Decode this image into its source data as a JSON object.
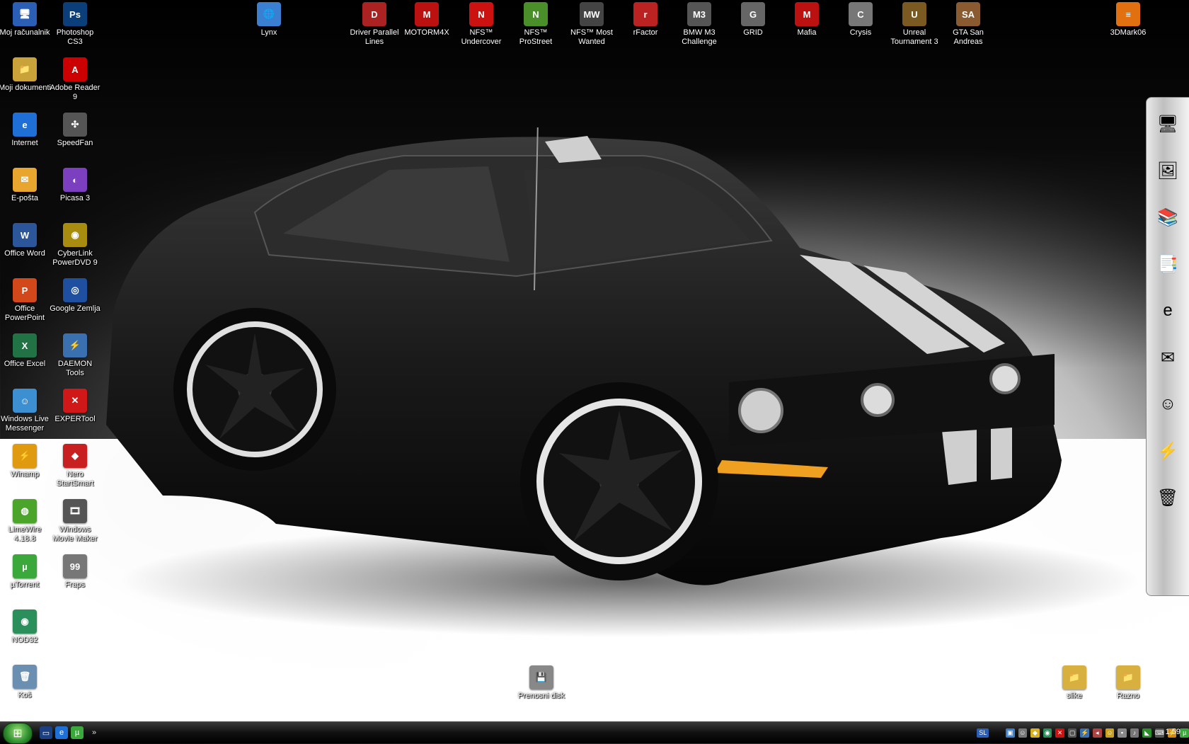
{
  "icons_left": [
    {
      "id": "computer",
      "label": "Moj računalnik",
      "glyph": "🖥",
      "color": "#2a5fb5"
    },
    {
      "id": "photoshop",
      "label": "Photoshop CS3",
      "glyph": "Ps",
      "color": "#0b3f7a"
    },
    {
      "id": "documents",
      "label": "Moji dokumenti",
      "glyph": "📁",
      "color": "#c9a23a"
    },
    {
      "id": "adobe-reader",
      "label": "Adobe Reader 9",
      "glyph": "A",
      "color": "#c00"
    },
    {
      "id": "internet",
      "label": "Internet",
      "glyph": "e",
      "color": "#1e6fd6"
    },
    {
      "id": "speedfan",
      "label": "SpeedFan",
      "glyph": "✣",
      "color": "#555"
    },
    {
      "id": "eposta",
      "label": "E-pošta",
      "glyph": "✉",
      "color": "#e8a62e"
    },
    {
      "id": "picasa",
      "label": "Picasa 3",
      "glyph": "◐",
      "color": "#7b3fbf"
    },
    {
      "id": "word",
      "label": "Office Word",
      "glyph": "W",
      "color": "#2b579a"
    },
    {
      "id": "powerdvd",
      "label": "CyberLink PowerDVD 9",
      "glyph": "◉",
      "color": "#a88c10"
    },
    {
      "id": "powerpoint",
      "label": "Office PowerPoint",
      "glyph": "P",
      "color": "#d2481b"
    },
    {
      "id": "google-earth",
      "label": "Google Zemlja",
      "glyph": "◎",
      "color": "#1f4f9f"
    },
    {
      "id": "excel",
      "label": "Office Excel",
      "glyph": "X",
      "color": "#217346"
    },
    {
      "id": "daemon",
      "label": "DAEMON Tools",
      "glyph": "⚡",
      "color": "#3a6fb0"
    },
    {
      "id": "messenger",
      "label": "Windows Live Messenger",
      "glyph": "☺",
      "color": "#3c8fd0"
    },
    {
      "id": "expertool",
      "label": "EXPERTool",
      "glyph": "✕",
      "color": "#d01818"
    },
    {
      "id": "winamp",
      "label": "Winamp",
      "glyph": "⚡",
      "color": "#e09a10"
    },
    {
      "id": "nero",
      "label": "Nero StartSmart",
      "glyph": "◆",
      "color": "#c82020"
    },
    {
      "id": "limewire",
      "label": "LimeWire 4.18.8",
      "glyph": "◍",
      "color": "#4aa52a"
    },
    {
      "id": "moviemaker",
      "label": "Windows Movie Maker",
      "glyph": "🎞",
      "color": "#555"
    },
    {
      "id": "utorrent",
      "label": "µTorrent",
      "glyph": "µ",
      "color": "#3aa83a"
    },
    {
      "id": "fraps",
      "label": "Fraps",
      "glyph": "99",
      "color": "#777"
    },
    {
      "id": "nod32",
      "label": "NOD32",
      "glyph": "◉",
      "color": "#2a8f5a"
    },
    {
      "id": "recycle",
      "label": "Koš",
      "glyph": "🗑",
      "color": "#6a8fb0"
    }
  ],
  "icons_top": [
    {
      "id": "lynx",
      "label": "Lynx",
      "glyph": "🌐",
      "color": "#3a7fd0"
    },
    {
      "id": "driver",
      "label": "Driver Parallel Lines",
      "glyph": "D",
      "color": "#a22"
    },
    {
      "id": "motorm4x",
      "label": "MOTORM4X",
      "glyph": "M",
      "color": "#b11"
    },
    {
      "id": "nfs-undercover",
      "label": "NFS™ Undercover",
      "glyph": "N",
      "color": "#c11"
    },
    {
      "id": "nfs-prostreet",
      "label": "NFS™ ProStreet",
      "glyph": "N",
      "color": "#4a8f2a"
    },
    {
      "id": "nfs-mostwanted",
      "label": "NFS™ Most Wanted",
      "glyph": "MW",
      "color": "#444"
    },
    {
      "id": "rfactor",
      "label": "rFactor",
      "glyph": "r",
      "color": "#b22"
    },
    {
      "id": "bmw",
      "label": "BMW M3 Challenge",
      "glyph": "M3",
      "color": "#555"
    },
    {
      "id": "grid",
      "label": "GRID",
      "glyph": "G",
      "color": "#666"
    },
    {
      "id": "mafia",
      "label": "Mafia",
      "glyph": "M",
      "color": "#b11"
    },
    {
      "id": "crysis",
      "label": "Crysis",
      "glyph": "C",
      "color": "#777"
    },
    {
      "id": "ut3",
      "label": "Unreal Tournament 3",
      "glyph": "U",
      "color": "#7a5a20"
    },
    {
      "id": "gtasa",
      "label": "GTA San Andreas",
      "glyph": "SA",
      "color": "#8a5a30"
    },
    {
      "id": "3dmark",
      "label": "3DMark06",
      "glyph": "≡",
      "color": "#e07010"
    }
  ],
  "icons_bottom": [
    {
      "id": "removable",
      "label": "Prenosni disk",
      "glyph": "💾",
      "color": "#888"
    },
    {
      "id": "slike",
      "label": "slike",
      "glyph": "📁",
      "color": "#d8b040"
    },
    {
      "id": "razno",
      "label": "Razno",
      "glyph": "📁",
      "color": "#d8b040"
    }
  ],
  "dock": [
    "🖥",
    "🖼",
    "📚",
    "📑",
    "e",
    "✉",
    "☺",
    "⚡",
    "🗑"
  ],
  "taskbar": {
    "clock": "1:59",
    "language": "SL",
    "chevron": "»"
  }
}
